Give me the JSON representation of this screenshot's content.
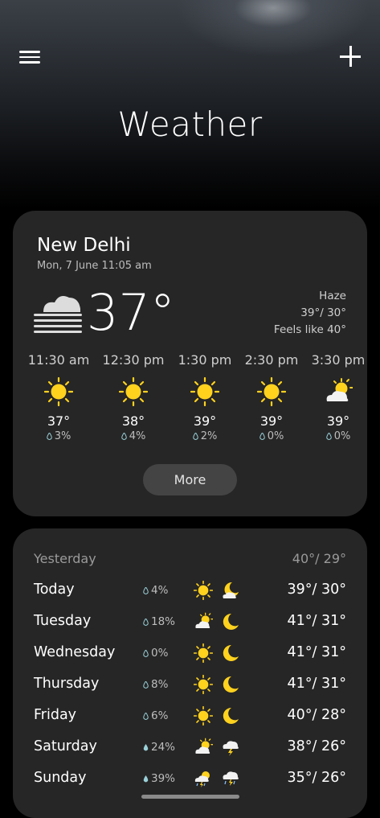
{
  "header": {
    "title": "Weather"
  },
  "current": {
    "city": "New Delhi",
    "datetime": "Mon, 7 June 11:05 am",
    "temp": "37°",
    "condition": "Haze",
    "hi_lo": "39°/ 30°",
    "feels_like": "Feels like 40°",
    "icon": "haze-icon"
  },
  "hourly": [
    {
      "time": "11:30 am",
      "temp": "37°",
      "precip": "3%",
      "icon": "sun-icon"
    },
    {
      "time": "12:30 pm",
      "temp": "38°",
      "precip": "4%",
      "icon": "sun-icon"
    },
    {
      "time": "1:30 pm",
      "temp": "39°",
      "precip": "2%",
      "icon": "sun-icon"
    },
    {
      "time": "2:30 pm",
      "temp": "39°",
      "precip": "0%",
      "icon": "sun-icon"
    },
    {
      "time": "3:30 pm",
      "temp": "39°",
      "precip": "0%",
      "icon": "partly-cloudy-icon"
    }
  ],
  "more_label": "More",
  "yesterday": {
    "label": "Yesterday",
    "hi_lo": "40°/ 29°"
  },
  "daily": [
    {
      "day": "Today",
      "precip": "4%",
      "day_icon": "sun-icon",
      "night_icon": "cloudy-moon-icon",
      "hi_lo": "39°/ 30°"
    },
    {
      "day": "Tuesday",
      "precip": "18%",
      "day_icon": "partly-cloudy-icon",
      "night_icon": "moon-icon",
      "hi_lo": "41°/ 31°"
    },
    {
      "day": "Wednesday",
      "precip": "0%",
      "day_icon": "sun-icon",
      "night_icon": "moon-icon",
      "hi_lo": "41°/ 31°"
    },
    {
      "day": "Thursday",
      "precip": "8%",
      "day_icon": "sun-icon",
      "night_icon": "moon-icon",
      "hi_lo": "41°/ 31°"
    },
    {
      "day": "Friday",
      "precip": "6%",
      "day_icon": "sun-icon",
      "night_icon": "moon-icon",
      "hi_lo": "40°/ 28°"
    },
    {
      "day": "Saturday",
      "precip": "24%",
      "day_icon": "partly-cloudy-icon",
      "night_icon": "thunderstorm-icon",
      "hi_lo": "38°/ 26°"
    },
    {
      "day": "Sunday",
      "precip": "39%",
      "day_icon": "sun-rain-storm-icon",
      "night_icon": "rain-storm-icon",
      "hi_lo": "35°/ 26°"
    }
  ],
  "colors": {
    "sun": "#ffd21e",
    "card": "#262626",
    "button": "#444444",
    "moon": "#ffd21e"
  }
}
